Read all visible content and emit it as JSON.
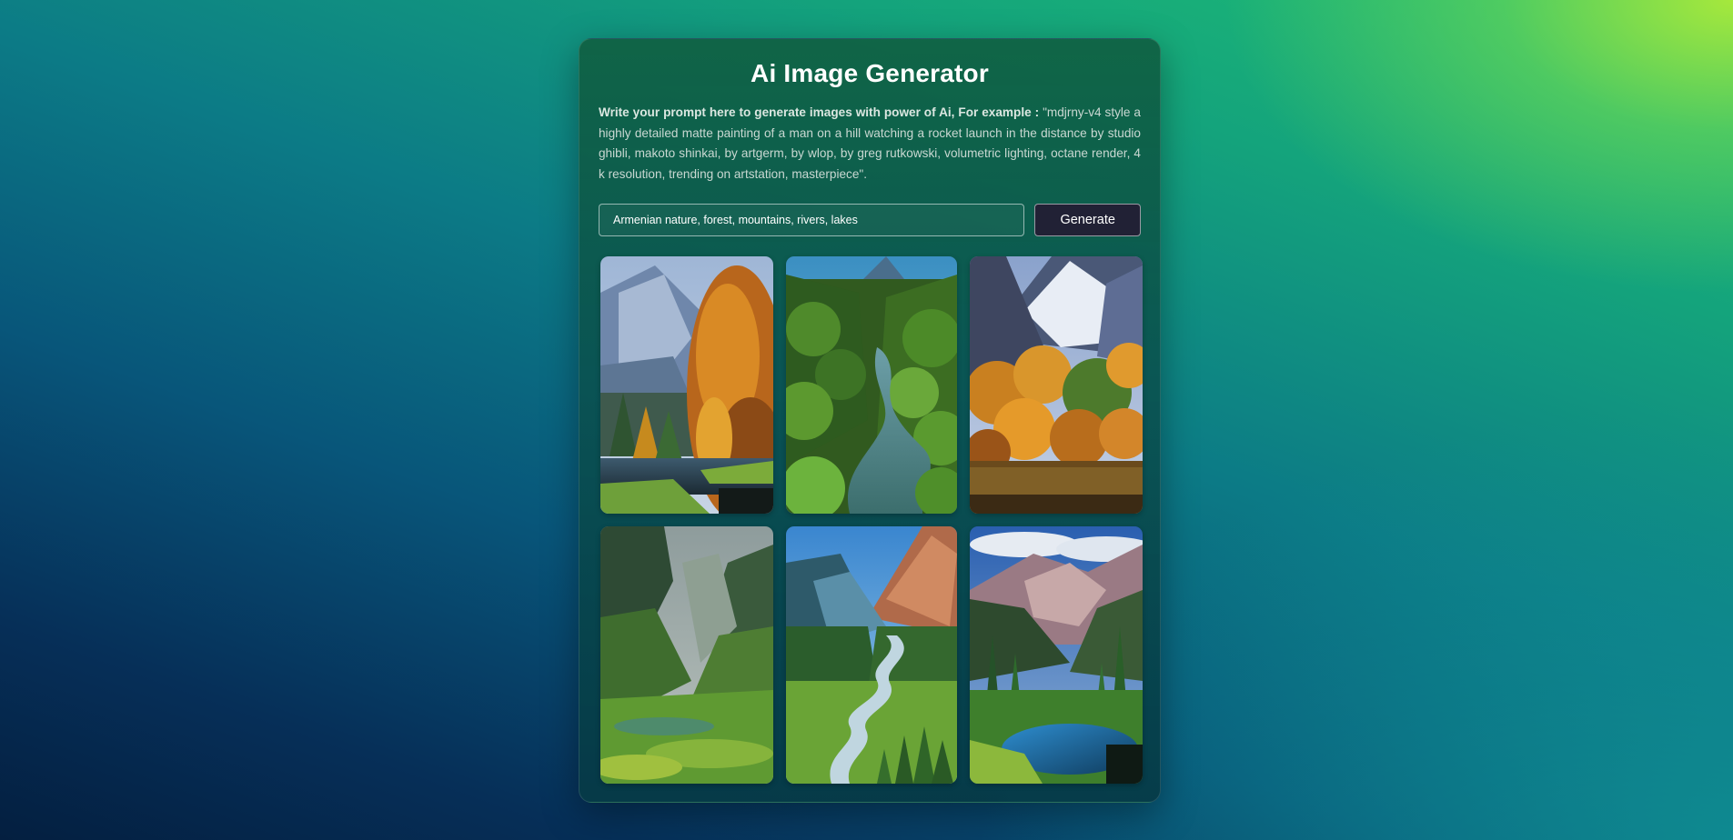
{
  "app": {
    "title": "Ai Image Generator"
  },
  "description": {
    "lead": "Write your prompt here to generate images with power of Ai, For example :",
    "example": " \"mdjrny-v4 style a highly detailed matte painting of a man on a hill watching a rocket launch in the distance by studio ghibli, makoto shinkai, by artgerm, by wlop, by greg rutkowski, volumetric lighting, octane render, 4 k resolution, trending on artstation, masterpiece\"."
  },
  "form": {
    "prompt_value": "Armenian nature, forest, mountains, rivers, lakes",
    "generate_label": "Generate"
  },
  "colors": {
    "button_bg": "#212135",
    "title_text": "#ffffff",
    "bg_top_right": "#a6e83c",
    "bg_bottom_left": "#041f40"
  }
}
